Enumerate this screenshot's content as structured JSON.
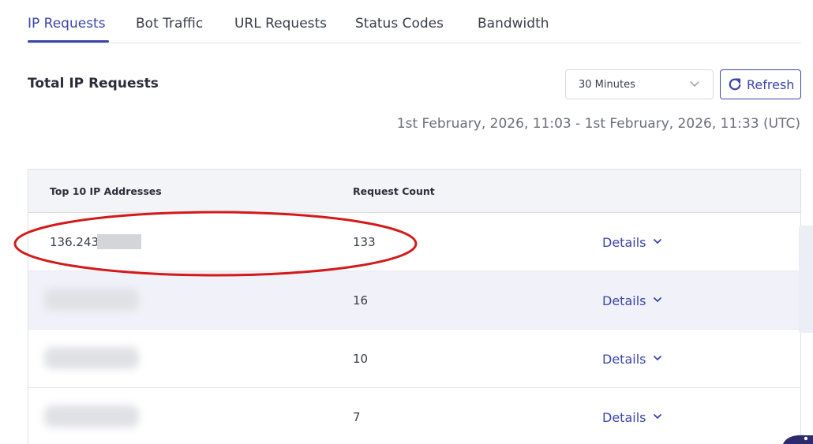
{
  "tabs": [
    {
      "label": "IP Requests",
      "active": true
    },
    {
      "label": "Bot Traffic",
      "active": false
    },
    {
      "label": "URL Requests",
      "active": false
    },
    {
      "label": "Status Codes",
      "active": false
    },
    {
      "label": "Bandwidth",
      "active": false
    }
  ],
  "section": {
    "title": "Total IP Requests"
  },
  "controls": {
    "timeframe": {
      "selected": "30 Minutes",
      "icon": "chevron-down-icon"
    },
    "refresh": {
      "label": "Refresh",
      "icon": "refresh-icon"
    }
  },
  "time_range": "1st February, 2026, 11:03 - 1st February, 2026, 11:33 (UTC)",
  "table": {
    "columns": [
      "Top 10 IP Addresses",
      "Request Count"
    ],
    "rows": [
      {
        "ip": "136.243.",
        "count": "133",
        "action": "Details",
        "ip_redacted": "partial"
      },
      {
        "ip": "",
        "count": "16",
        "action": "Details",
        "ip_redacted": "full"
      },
      {
        "ip": "",
        "count": "10",
        "action": "Details",
        "ip_redacted": "full"
      },
      {
        "ip": "",
        "count": "7",
        "action": "Details",
        "ip_redacted": "full"
      }
    ]
  },
  "colors": {
    "accent": "#3b45a8",
    "annotation": "#d31a1a",
    "header_bg": "#f3f4f7",
    "alt_row_bg": "#f1f2f9"
  }
}
